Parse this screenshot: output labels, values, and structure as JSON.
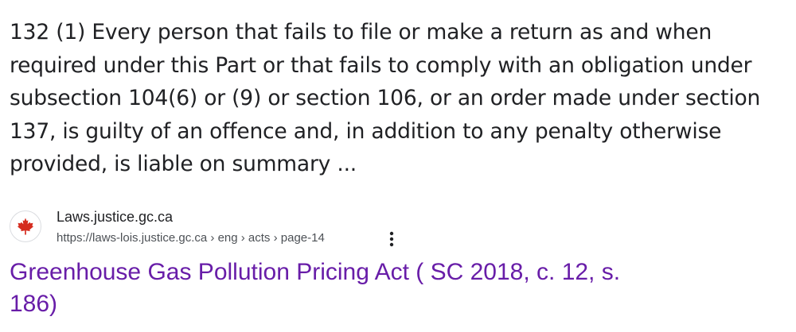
{
  "snippet": {
    "lines": [
      "132 (1) Every person that fails to file or make a return as and when",
      "required under this Part or that fails to comply with an obligation under",
      "subsection 104(6) or (9) or section 106, or an order made under section",
      "137, is guilty of an offence and, in addition to any penalty otherwise",
      "provided, is liable on summary ..."
    ]
  },
  "source": {
    "favicon_icon": "maple-leaf-icon",
    "site_name": "Laws.justice.gc.ca",
    "url": "https://laws-lois.justice.gc.ca › eng › acts › page-14",
    "more_icon": "vertical-dots-icon"
  },
  "result": {
    "title_line1": "Greenhouse Gas Pollution Pricing Act ( SC 2018, c. 12, s.",
    "title_line2": "186)"
  },
  "colors": {
    "snippet_text": "#202124",
    "url_text": "#4d5156",
    "visited_link": "#681da8",
    "maple_leaf": "#d52b1e"
  }
}
